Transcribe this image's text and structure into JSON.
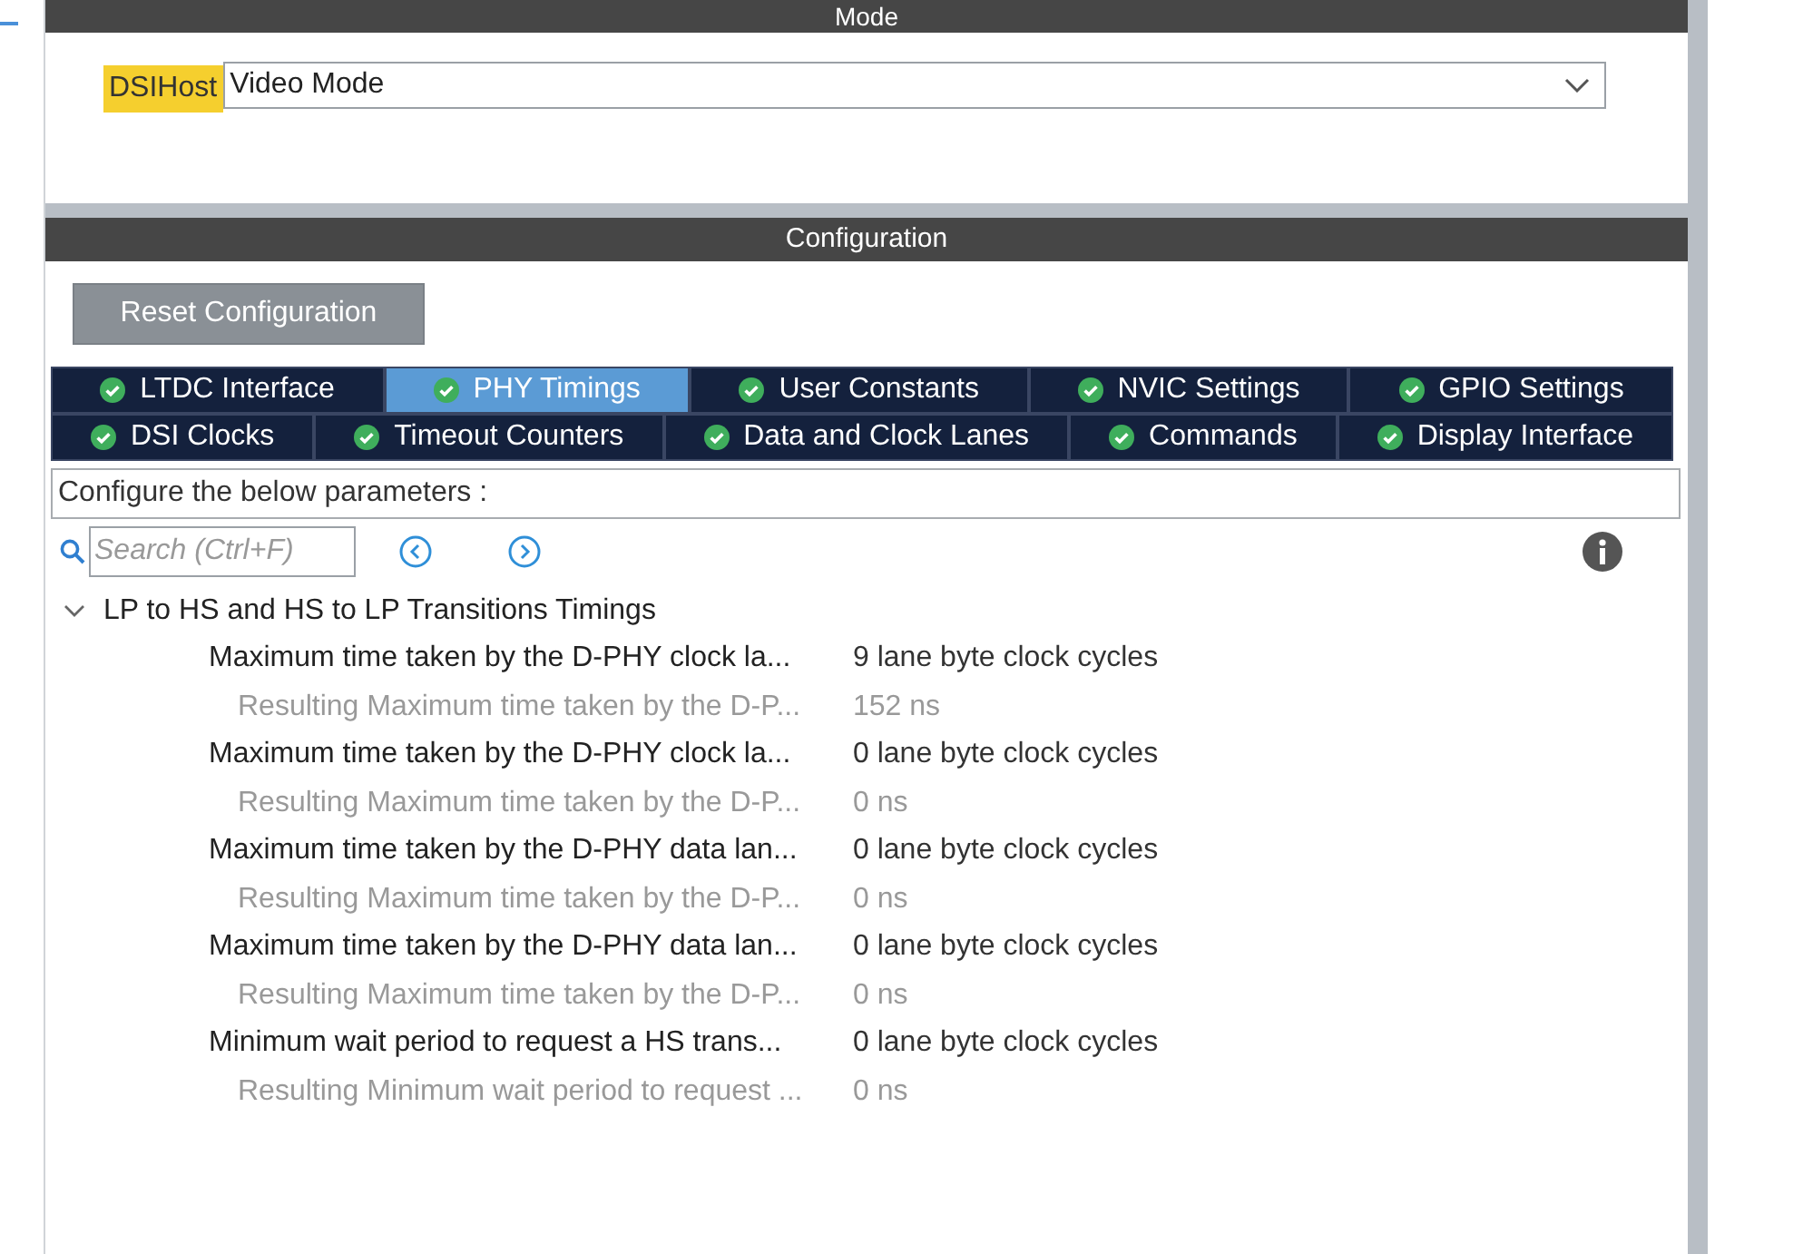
{
  "mode": {
    "title": "Mode",
    "label": "DSIHost",
    "value": "Video Mode"
  },
  "configuration": {
    "title": "Configuration",
    "reset_button": "Reset Configuration",
    "tab_rows": [
      [
        {
          "label": "LTDC Interface",
          "selected": false
        },
        {
          "label": "PHY Timings",
          "selected": true
        },
        {
          "label": "User Constants",
          "selected": false
        },
        {
          "label": "NVIC Settings",
          "selected": false
        },
        {
          "label": "GPIO Settings",
          "selected": false
        }
      ],
      [
        {
          "label": "DSI Clocks",
          "selected": false
        },
        {
          "label": "Timeout Counters",
          "selected": false
        },
        {
          "label": "Data and Clock Lanes",
          "selected": false
        },
        {
          "label": "Commands",
          "selected": false
        },
        {
          "label": "Display Interface",
          "selected": false
        }
      ]
    ],
    "description": "Configure the below parameters :",
    "search": {
      "placeholder": "Search (Ctrl+F)"
    },
    "tree": [
      {
        "label": "LP to HS and HS to LP Transitions Timings",
        "expanded": true,
        "children": [
          {
            "kind": "param",
            "name": "Maximum time taken by the D-PHY clock la...",
            "value": "9 lane byte clock cycles"
          },
          {
            "kind": "result",
            "name": "Resulting Maximum time taken by the D-P...",
            "value": "152 ns"
          },
          {
            "kind": "param",
            "name": "Maximum time taken by the D-PHY clock la...",
            "value": "0 lane byte clock cycles"
          },
          {
            "kind": "result",
            "name": "Resulting Maximum time taken by the D-P...",
            "value": "0 ns"
          },
          {
            "kind": "param",
            "name": "Maximum time taken by the D-PHY data lan...",
            "value": "0 lane byte clock cycles"
          },
          {
            "kind": "result",
            "name": "Resulting Maximum time taken by the D-P...",
            "value": "0 ns"
          },
          {
            "kind": "param",
            "name": "Maximum time taken by the D-PHY data lan...",
            "value": "0 lane byte clock cycles"
          },
          {
            "kind": "result",
            "name": "Resulting Maximum time taken by the D-P...",
            "value": "0 ns"
          },
          {
            "kind": "param",
            "name": "Minimum wait period to request a HS trans...",
            "value": "0 lane byte clock cycles"
          },
          {
            "kind": "result",
            "name": "Resulting Minimum wait period to request ...",
            "value": "0 ns"
          }
        ]
      }
    ]
  }
}
